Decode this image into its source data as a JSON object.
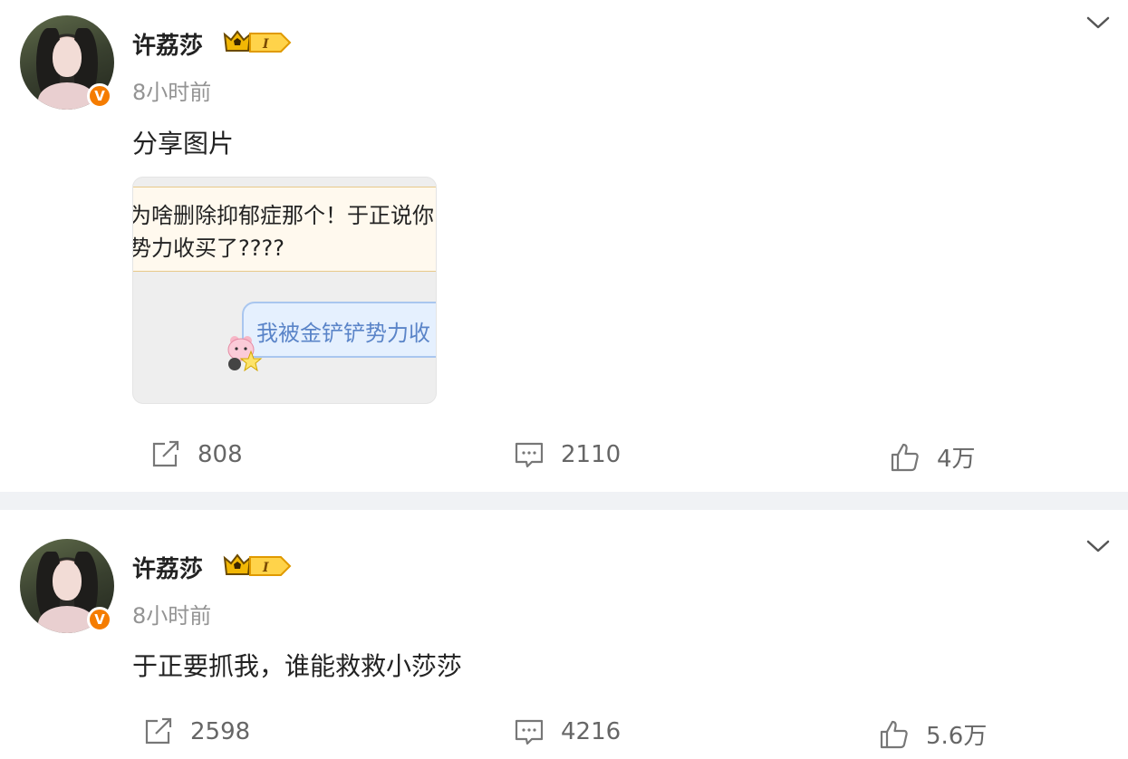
{
  "posts": [
    {
      "username": "许荔莎",
      "vip_level": "I",
      "verified_badge": "V",
      "time": "8小时前",
      "content": "分享图片",
      "image": {
        "line1": "为啥删除抑郁症那个！于正说你",
        "line2": "势力收买了????",
        "bubble": "我被金铲铲势力收"
      },
      "actions": {
        "repost": "808",
        "comment": "2110",
        "like": "4万"
      }
    },
    {
      "username": "许荔莎",
      "vip_level": "I",
      "verified_badge": "V",
      "time": "8小时前",
      "content": "于正要抓我，谁能救救小莎莎",
      "actions": {
        "repost": "2598",
        "comment": "4216",
        "like": "5.6万"
      }
    }
  ],
  "colors": {
    "badge_orange": "#f57c00",
    "separator": "#f0f2f5",
    "muted_text": "#939393"
  },
  "icons": [
    "chevron-down-icon",
    "repost-icon",
    "comment-icon",
    "like-icon",
    "vip-crown-icon"
  ]
}
